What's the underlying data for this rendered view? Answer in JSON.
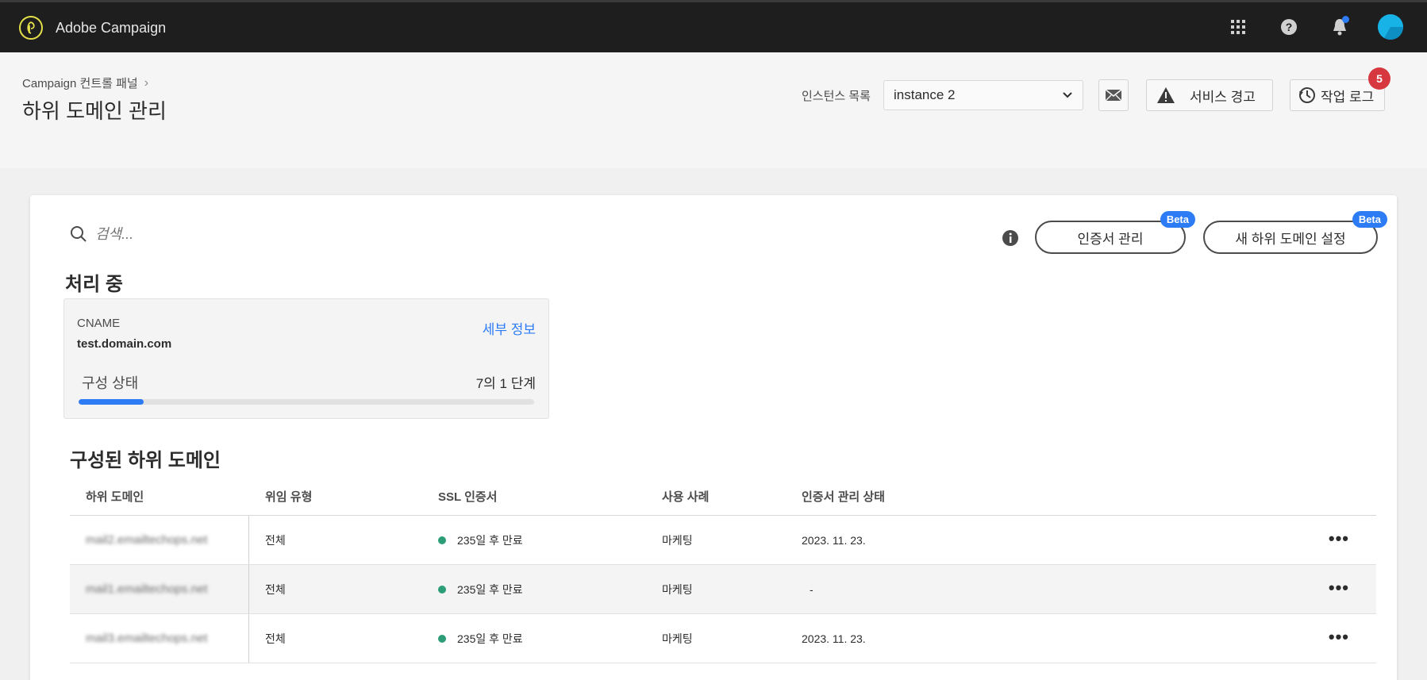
{
  "app": {
    "name": "Adobe Campaign"
  },
  "topbar": {
    "icons": [
      "apps-grid-icon",
      "help-icon",
      "notifications-bell-icon",
      "user-avatar"
    ],
    "accent_color": "#2d7cf6"
  },
  "header": {
    "breadcrumb": "Campaign 컨트롤 패널",
    "title": "하위 도메인 관리",
    "instance_label": "인스턴스 목록",
    "instance_value": "instance 2",
    "alert_label": "서비스 경고",
    "log_label": "작업 로그",
    "log_badge": "5"
  },
  "toolbar": {
    "search_placeholder": "검색...",
    "cert_button": "인증서 관리",
    "new_button": "새 하위 도메인 설정",
    "beta_label": "Beta"
  },
  "processing": {
    "title": "처리 중",
    "type": "CNAME",
    "domain": "test.domain.com",
    "details_link": "세부 정보",
    "status_label": "구성 상태",
    "step_text": "7의 1 단계",
    "progress_fraction": 0.143
  },
  "configured": {
    "title": "구성된 하위 도메인",
    "columns": [
      "하위 도메인",
      "위임 유형",
      "SSL 인증서",
      "사용 사례",
      "인증서 관리 상태"
    ],
    "rows": [
      {
        "subdomain": "mail2.emailtechops.net",
        "delegation": "전체",
        "ssl": "235일 후 만료",
        "use_case": "마케팅",
        "cert_status": "2023. 11. 23."
      },
      {
        "subdomain": "mail1.emailtechops.net",
        "delegation": "전체",
        "ssl": "235일 후 만료",
        "use_case": "마케팅",
        "cert_status": "-"
      },
      {
        "subdomain": "mail3.emailtechops.net",
        "delegation": "전체",
        "ssl": "235일 후 만료",
        "use_case": "마케팅",
        "cert_status": "2023. 11. 23."
      }
    ],
    "more_label": "•••"
  }
}
